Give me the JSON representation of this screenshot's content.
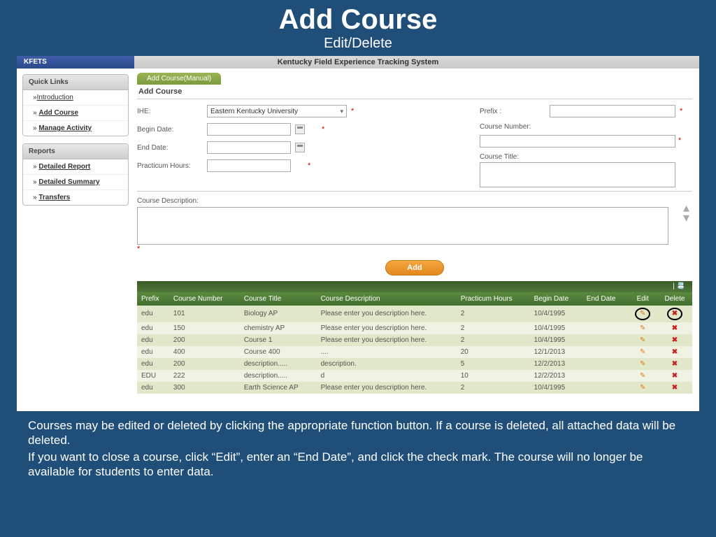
{
  "slide": {
    "title": "Add Course",
    "subtitle": "Edit/Delete"
  },
  "app": {
    "brand": "KFETS",
    "title": "Kentucky Field Experience Tracking System"
  },
  "sidebar": {
    "groups": [
      {
        "header": "Quick Links",
        "items": [
          {
            "label": "Introduction"
          },
          {
            "label": "Add Course"
          },
          {
            "label": "Manage Activity"
          }
        ]
      },
      {
        "header": "Reports",
        "items": [
          {
            "label": "Detailed Report"
          },
          {
            "label": "Detailed Summary"
          },
          {
            "label": "Transfers"
          }
        ]
      }
    ]
  },
  "form": {
    "tab": "Add Course(Manual)",
    "section": "Add Course",
    "labels": {
      "ihe": "IHE:",
      "begin": "Begin Date:",
      "end": "End Date:",
      "hours": "Practicum Hours:",
      "prefix": "Prefix :",
      "cnum": "Course Number:",
      "ctitle": "Course Title:",
      "cdesc": "Course Description:"
    },
    "ihe_value": "Eastern Kentucky University",
    "add_button": "Add"
  },
  "grid": {
    "toolbar": "| 📇",
    "headers": [
      "Prefix",
      "Course Number",
      "Course Title",
      "Course Description",
      "Practicum Hours",
      "Begin Date",
      "End Date",
      "Edit",
      "Delete"
    ],
    "rows": [
      {
        "prefix": "edu",
        "num": "101",
        "title": "Biology AP",
        "desc": "Please enter you description here.",
        "hours": "2",
        "begin": "10/4/1995",
        "end": ""
      },
      {
        "prefix": "edu",
        "num": "150",
        "title": "chemistry AP",
        "desc": "Please enter you description here.",
        "hours": "2",
        "begin": "10/4/1995",
        "end": ""
      },
      {
        "prefix": "edu",
        "num": "200",
        "title": "Course 1",
        "desc": "Please enter you description here.",
        "hours": "2",
        "begin": "10/4/1995",
        "end": ""
      },
      {
        "prefix": "edu",
        "num": "400",
        "title": "Course 400",
        "desc": "....",
        "hours": "20",
        "begin": "12/1/2013",
        "end": ""
      },
      {
        "prefix": "edu",
        "num": "200",
        "title": "description.....",
        "desc": "description.",
        "hours": "5",
        "begin": "12/2/2013",
        "end": ""
      },
      {
        "prefix": "EDU",
        "num": "222",
        "title": "description.....",
        "desc": "d",
        "hours": "10",
        "begin": "12/2/2013",
        "end": ""
      },
      {
        "prefix": "edu",
        "num": "300",
        "title": "Earth Science AP",
        "desc": "Please enter you description here.",
        "hours": "2",
        "begin": "10/4/1995",
        "end": ""
      }
    ]
  },
  "footer": {
    "p1": "Courses may be edited or deleted by clicking the appropriate function button. If a course is deleted, all attached data will be deleted.",
    "p2": "If you want to close a course, click “Edit”, enter an “End Date”, and click the check mark. The course will no longer be available for students to enter data."
  }
}
